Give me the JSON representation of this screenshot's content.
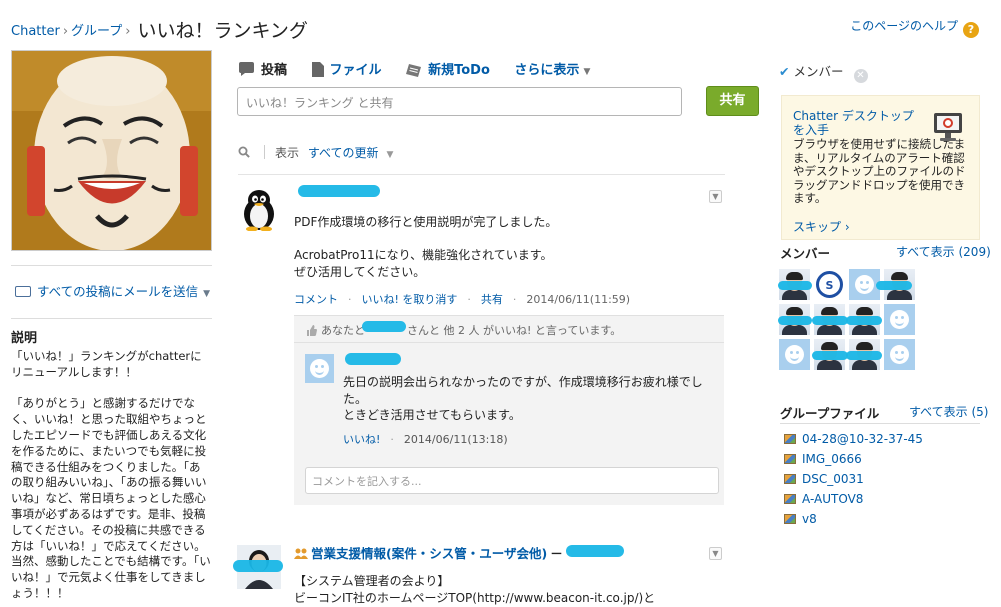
{
  "header": {
    "breadcrumb": [
      "Chatter",
      "グループ"
    ],
    "breadcrumb_sep": "›",
    "title": "いいね！ランキング",
    "help_link": "このページのヘルプ",
    "help_icon": "?"
  },
  "left": {
    "email_link": "すべての投稿にメールを送信",
    "description_heading": "説明",
    "description_text": "「いいね！」ランキングがchatterにリニューアルします！！\n\n「ありがとう」と感謝するだけでなく、いいね！と思った取組やちょっとしたエピソードでも評価しあえる文化を作るために、またいつでも気軽に投稿できる仕組みをつくりました。「あの取り組みいいね」、「あの振る舞いいいね」など、常日頃ちょっとした感心事項が必ずあるはずです。是非、投稿してください。その投稿に共感できる方は「いいね！」で応えてください。当然、感動したことでも結構です。「いいね！」で元気よく仕事をしてきましょう！！！"
  },
  "publisher": {
    "tabs": [
      {
        "label": "投稿",
        "icon": "speech-bubble-icon"
      },
      {
        "label": "ファイル",
        "icon": "document-icon"
      },
      {
        "label": "新規ToDo",
        "icon": "notepad-icon"
      },
      {
        "label": "さらに表示",
        "icon": "chevron-down-icon"
      }
    ],
    "share_placeholder": "いいね！ランキング と共有",
    "share_button": "共有"
  },
  "feed_filter": {
    "show_label": "表示",
    "selected": "すべての更新"
  },
  "post1": {
    "body": "PDF作成環境の移行と使用説明が完了しました。\n\nAcrobatPro11になり、機能強化されています。\nぜひ活用してください。",
    "actions": [
      "コメント",
      "いいね! を取り消す",
      "共有"
    ],
    "timestamp": "2014/06/11(11:59)",
    "likes_prefix": "あなたと",
    "likes_suffix": "さんと 他 2 人 がいいね! と言っています。",
    "comment": {
      "body": "先日の説明会出られなかったのですが、作成環境移行お疲れ様でした。\nときどき活用させてもらいます。",
      "like": "いいね!",
      "timestamp": "2014/06/11(13:18)"
    },
    "comment_placeholder": "コメントを記入する..."
  },
  "post2": {
    "group": "営業支援情報(案件・シス管・ユーザ会他)",
    "arrow": "－",
    "body": "【システム管理者の会より】\nビーコンIT社のホームページTOP(http://www.beacon-it.co.jp/)と"
  },
  "right": {
    "members_toggle": "メンバー",
    "promo_title": "Chatter デスクトップを入手",
    "promo_text": "ブラウザを使用せずに接続したまま、リアルタイムのアラート確認やデスクトップ上のファイルのドラッグアンドドロップを使用できます。",
    "promo_skip": "スキップ ›",
    "members_heading": "メンバー",
    "members_all": "すべて表示 (209)",
    "files_heading": "グループファイル",
    "files_all": "すべて表示 (5)",
    "files": [
      "04-28@10-32-37-45",
      "IMG_0666",
      "DSC_0031",
      "A-AUTOV8",
      "v8"
    ]
  },
  "colors": {
    "link": "#015ba7",
    "share_button": "#7aab2b",
    "promo_bg": "#fdf8e4",
    "redaction": "#19b6e6"
  }
}
